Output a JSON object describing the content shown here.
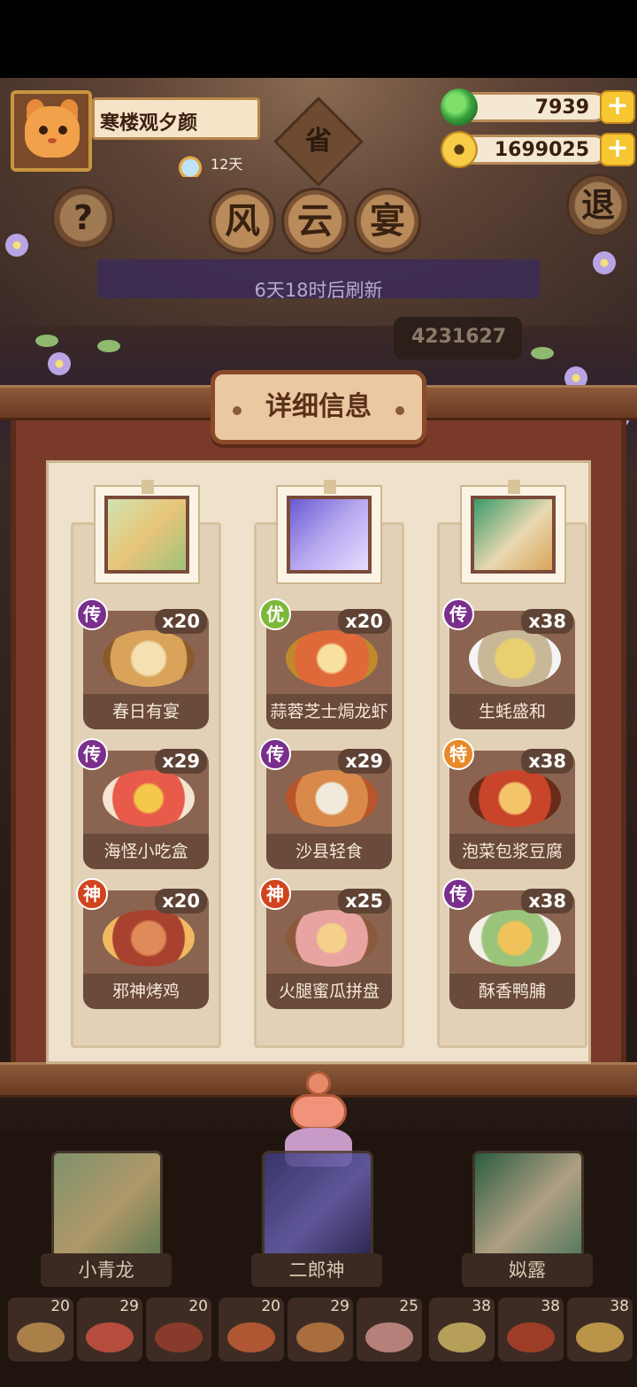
{
  "player": {
    "name": "寒楼观夕颜",
    "days": "12天"
  },
  "currency": {
    "jade": "7939",
    "coins": "1699025",
    "add_label": "+"
  },
  "header": {
    "help_label": "?",
    "exit_label": "退",
    "province_label": "省",
    "title_chars": [
      "风",
      "云",
      "宴"
    ],
    "refresh_text": "6天18时后刷新",
    "score_partial": "4231627"
  },
  "panel": {
    "title": "详细信息"
  },
  "dishes": [
    {
      "rank": "传",
      "count": "x20",
      "name": "春日有宴",
      "color": "#d9a45a"
    },
    {
      "rank": "优",
      "count": "x20",
      "name": "蒜蓉芝士焗龙虾",
      "color": "#e0693a"
    },
    {
      "rank": "传",
      "count": "x38",
      "name": "生蚝盛和",
      "color": "#e8d070"
    },
    {
      "rank": "传",
      "count": "x29",
      "name": "海怪小吃盒",
      "color": "#e85a4a"
    },
    {
      "rank": "传",
      "count": "x29",
      "name": "沙县轻食",
      "color": "#d98a4a"
    },
    {
      "rank": "特",
      "count": "x38",
      "name": "泡菜包浆豆腐",
      "color": "#c8442a"
    },
    {
      "rank": "神",
      "count": "x20",
      "name": "邪神烤鸡",
      "color": "#a8422e"
    },
    {
      "rank": "神",
      "count": "x25",
      "name": "火腿蜜瓜拼盘",
      "color": "#e8a4a0"
    },
    {
      "rank": "传",
      "count": "x38",
      "name": "酥香鸭脯",
      "color": "#f0c25a"
    }
  ],
  "characters": [
    {
      "name": "小青龙"
    },
    {
      "name": "二郎神"
    },
    {
      "name": "姒露"
    }
  ],
  "mini_counts": [
    "20",
    "29",
    "20",
    "20",
    "29",
    "25",
    "38",
    "38",
    "38"
  ]
}
